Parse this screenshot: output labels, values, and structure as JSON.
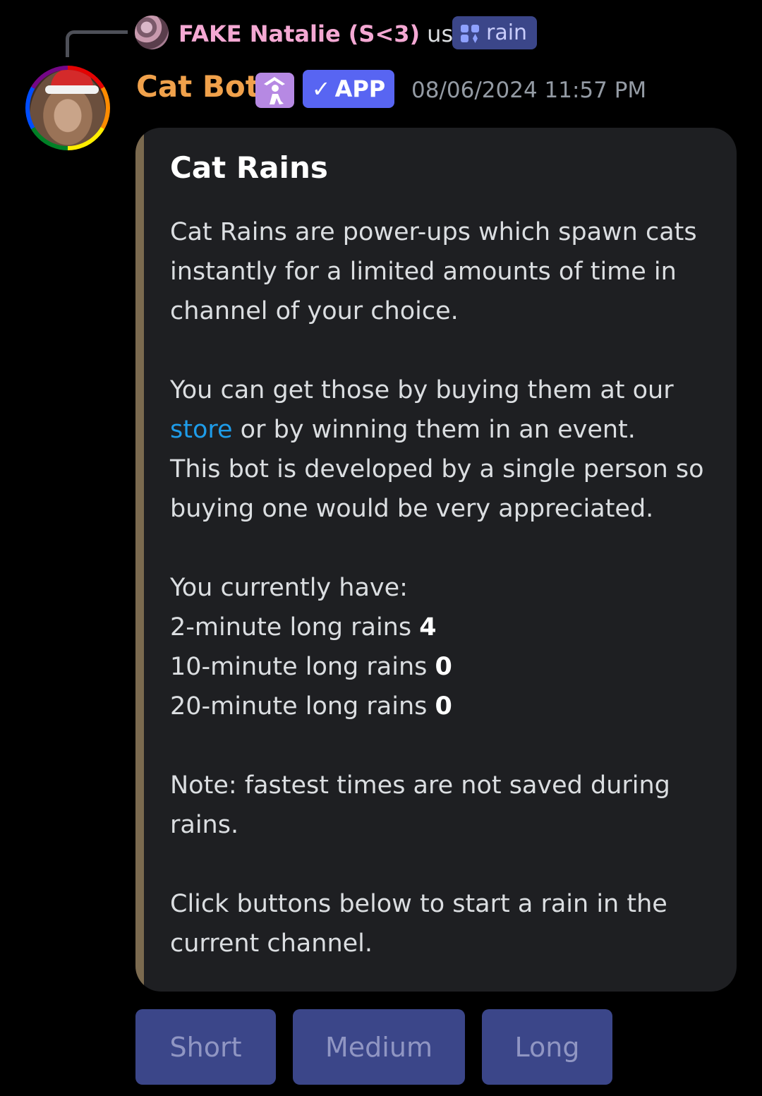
{
  "reply": {
    "username": "FAKE Natalie (S<3)",
    "used_text": "used",
    "command": "rain",
    "command_icon": "slash-command-icon"
  },
  "message": {
    "author": "Cat Bot",
    "app_badge": "APP",
    "timestamp": "08/06/2024 11:57 PM"
  },
  "embed": {
    "title": "Cat Rains",
    "accent_color": "#7b6a4f",
    "intro": "Cat Rains are power-ups which spawn cats instantly for a limited amounts of time in channel of your choice.",
    "buy_prefix": "You can get those by buying them at our",
    "store_link": "store",
    "buy_suffix": "or by winning them in an event.",
    "support": "This bot is developed by a single person so buying one would be very appreciated.",
    "have_heading": "You currently have:",
    "rains": [
      {
        "label": "2-minute long rains",
        "count": "4"
      },
      {
        "label": "10-minute long rains",
        "count": "0"
      },
      {
        "label": "20-minute long rains",
        "count": "0"
      }
    ],
    "note": "Note: fastest times are not saved during rains.",
    "instructions": "Click buttons below to start a rain in the current channel."
  },
  "buttons": {
    "short": "Short",
    "medium": "Medium",
    "long": "Long"
  }
}
